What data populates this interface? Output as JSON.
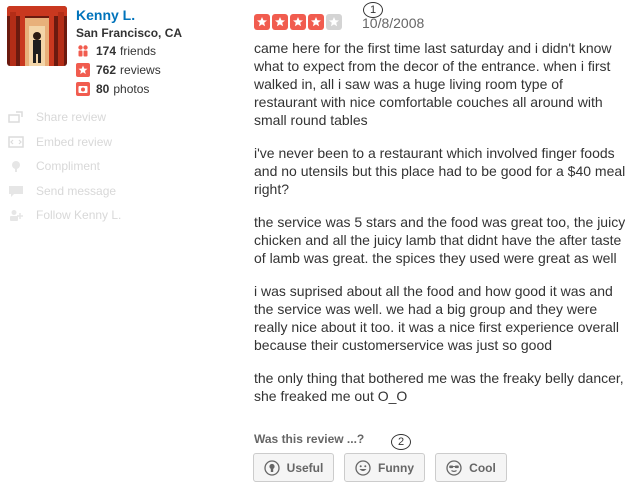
{
  "user": {
    "name": "Kenny L.",
    "location": "San Francisco, CA",
    "friends_count": "174",
    "friends_label": "friends",
    "reviews_count": "762",
    "reviews_label": "reviews",
    "photos_count": "80",
    "photos_label": "photos"
  },
  "profile_actions": [
    {
      "label": "Share review",
      "icon": "share-icon"
    },
    {
      "label": "Embed review",
      "icon": "embed-icon"
    },
    {
      "label": "Compliment",
      "icon": "compliment-icon"
    },
    {
      "label": "Send message",
      "icon": "message-icon"
    },
    {
      "label": "Follow Kenny L.",
      "icon": "follow-icon"
    }
  ],
  "review": {
    "rating": 4,
    "max_rating": 5,
    "date": "10/8/2008",
    "paragraphs": [
      "came here for the first time last saturday and i didn't know what to expect from the decor of the entrance. when i first walked in, all i saw was a huge living room type of restaurant with nice comfortable couches all around with small round tables",
      "i've never been to a restaurant which involved finger foods and no utensils but this place had to be good for a $40 meal right?",
      "the service was 5 stars and the food was great too, the juicy chicken and all the juicy lamb that didnt have the after taste of lamb was great. the spices they used were great as well",
      "i was suprised about all the food and how good it was and the service was well. we had a big group and they were really nice about it too. it was a nice first experience overall because their customerservice was just so good",
      "the only thing that bothered me was the freaky belly dancer, she freaked me out O_O"
    ]
  },
  "markers": {
    "one": "1",
    "two": "2"
  },
  "votes": {
    "question": "Was this review ...?",
    "useful": "Useful",
    "funny": "Funny",
    "cool": "Cool"
  },
  "colors": {
    "accent_link": "#0073bb",
    "star_on": "#f15c4f",
    "star_off": "#d4d4d4",
    "stat_icon": "#f15c4f"
  }
}
